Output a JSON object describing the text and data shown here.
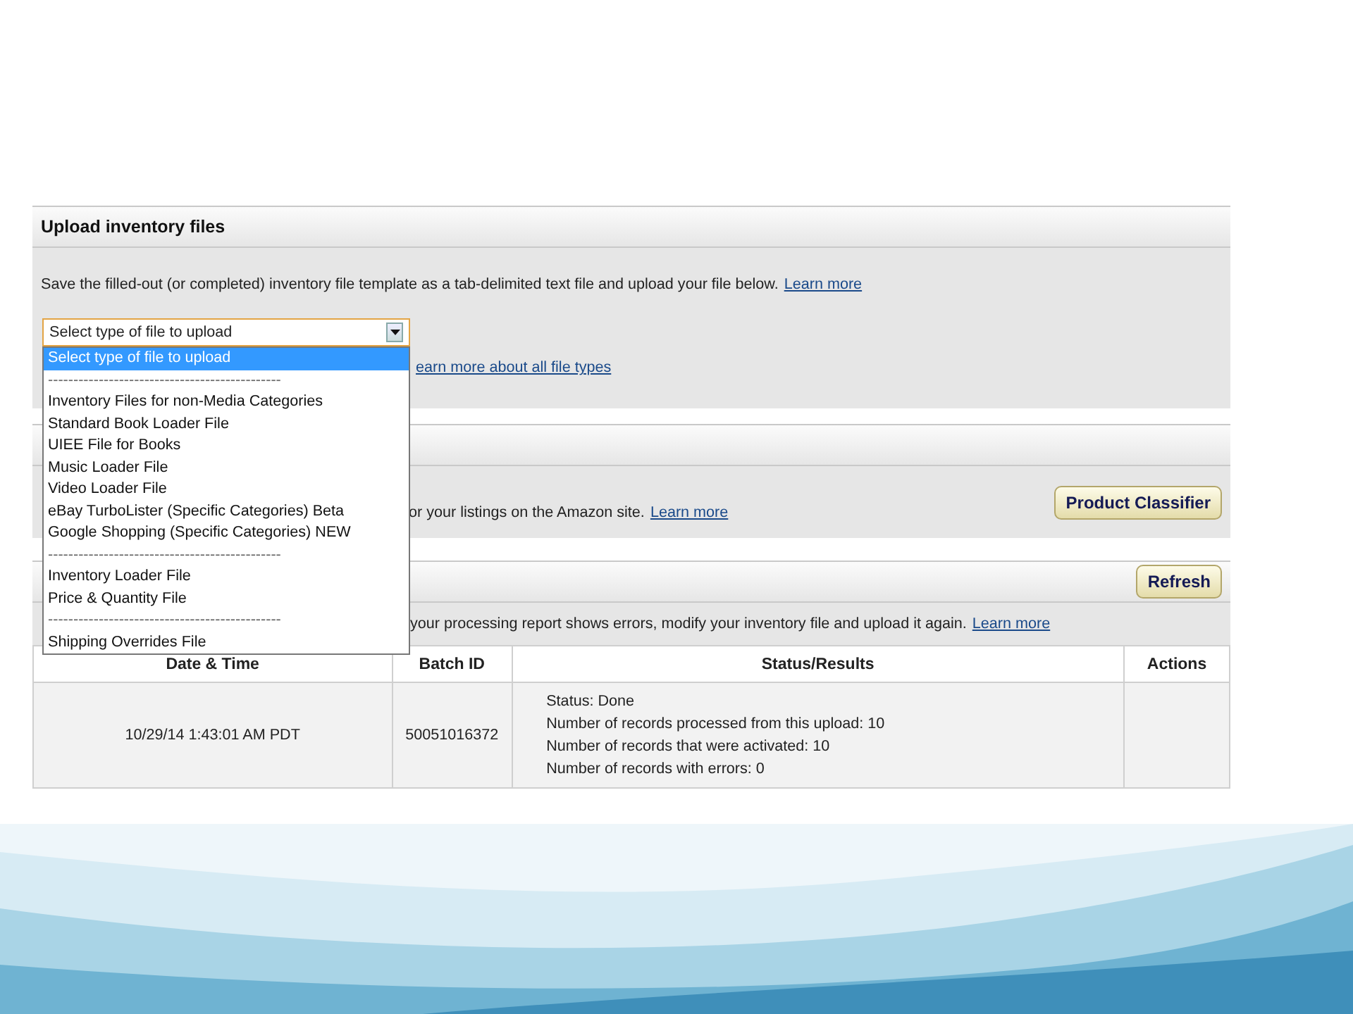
{
  "upload_section": {
    "title": "Upload inventory files",
    "description": "Save the filled-out (or completed) inventory file template as a tab-delimited text file and upload your file below.",
    "learn_more": "Learn more",
    "file_type_select": {
      "value": "Select type of file to upload",
      "expanded": true,
      "options": [
        {
          "kind": "option",
          "label": "Select type of file to upload",
          "selected": true
        },
        {
          "kind": "separator",
          "label": "----------------------------------------------",
          "selected": false
        },
        {
          "kind": "option",
          "label": "Inventory Files for non-Media Categories",
          "selected": false
        },
        {
          "kind": "option",
          "label": "Standard Book Loader File",
          "selected": false
        },
        {
          "kind": "option",
          "label": "UIEE File for Books",
          "selected": false
        },
        {
          "kind": "option",
          "label": "Music Loader File",
          "selected": false
        },
        {
          "kind": "option",
          "label": "Video Loader File",
          "selected": false
        },
        {
          "kind": "option",
          "label": "eBay TurboLister (Specific Categories) Beta",
          "selected": false
        },
        {
          "kind": "option",
          "label": "Google Shopping (Specific Categories) NEW",
          "selected": false
        },
        {
          "kind": "separator",
          "label": "----------------------------------------------",
          "selected": false
        },
        {
          "kind": "option",
          "label": "Inventory Loader File",
          "selected": false
        },
        {
          "kind": "option",
          "label": "Price & Quantity File",
          "selected": false
        },
        {
          "kind": "separator",
          "label": "----------------------------------------------",
          "selected": false
        },
        {
          "kind": "option",
          "label": "Shipping Overrides File",
          "selected": false
        }
      ]
    },
    "file_types_link": "earn more about all file types"
  },
  "classifier_section": {
    "description": "or your listings on the Amazon site.",
    "learn_more": "Learn more",
    "button": "Product Classifier"
  },
  "status_section": {
    "button": "Refresh",
    "description": "your processing report shows errors, modify your inventory file and upload it again.",
    "learn_more": "Learn more",
    "table": {
      "columns": [
        "Date & Time",
        "Batch ID",
        "Status/Results",
        "Actions"
      ],
      "rows": [
        {
          "date_time": "10/29/14 1:43:01 AM PDT",
          "batch_id": "50051016372",
          "status_results": [
            "Status: Done",
            "Number of records processed from this upload: 10",
            "Number of records that were activated: 10",
            "Number of records with errors: 0"
          ]
        }
      ]
    }
  }
}
